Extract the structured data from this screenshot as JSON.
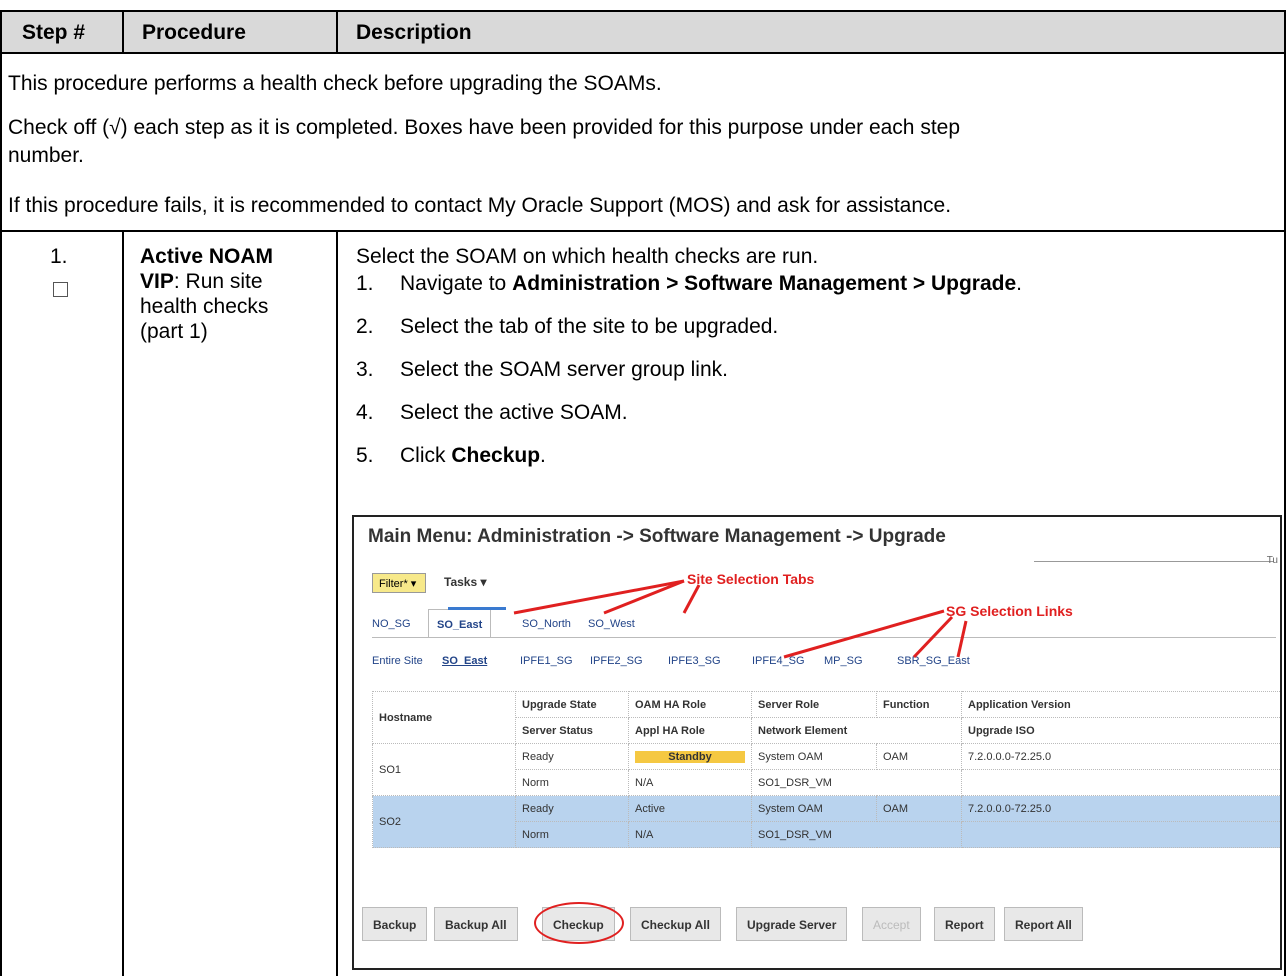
{
  "header": {
    "step": "Step #",
    "procedure": "Procedure",
    "description": "Description"
  },
  "intro": {
    "line1": "This procedure performs a health check before upgrading the SOAMs.",
    "line2a": "Check off (√) each step as it is completed.  Boxes have been provided for this purpose under each step",
    "line2b": "number.",
    "line3": "If this procedure fails, it is recommended to contact My Oracle Support (MOS) and ask for assistance."
  },
  "step": {
    "number": "1.",
    "proc_bold1": "Active NOAM",
    "proc_bold2": "VIP",
    "proc_rest": ": Run site",
    "proc_line2": "health checks",
    "proc_line3": "(part 1)",
    "lead": "Select the SOAM on which health checks are run.",
    "items": [
      {
        "num": "1.",
        "pre": "Navigate to ",
        "bold": "Administration > Software Management > Upgrade",
        "post": "."
      },
      {
        "num": "2.",
        "pre": "Select the tab of the site to be upgraded.",
        "bold": "",
        "post": ""
      },
      {
        "num": "3.",
        "pre": "Select the SOAM server group link.",
        "bold": "",
        "post": ""
      },
      {
        "num": "4.",
        "pre": "Select the active SOAM.",
        "bold": "",
        "post": ""
      },
      {
        "num": "5.",
        "pre": "Click ",
        "bold": "Checkup",
        "post": "."
      }
    ]
  },
  "screenshot": {
    "title": "Main Menu: Administration -> Software Management -> Upgrade",
    "corner": "Tu",
    "filter": "Filter* ▾",
    "tasks": "Tasks ▾",
    "anno_tabs": "Site Selection Tabs",
    "anno_links": "SG Selection Links",
    "tabs": [
      "NO_SG",
      "SO_East",
      "SO_North",
      "SO_West"
    ],
    "sg_links": [
      "Entire Site",
      "SO_East",
      "IPFE1_SG",
      "IPFE2_SG",
      "IPFE3_SG",
      "IPFE4_SG",
      "MP_SG",
      "SBR_SG_East"
    ],
    "columns_top": [
      "Hostname",
      "Upgrade State",
      "OAM HA Role",
      "Server Role",
      "Function",
      "Application Version"
    ],
    "columns_bottom": [
      "Server Status",
      "Appl HA Role",
      "Network Element",
      "Upgrade ISO"
    ],
    "rows": [
      {
        "host": "SO1",
        "state": "Ready",
        "oam": "Standby",
        "role": "System OAM",
        "func": "OAM",
        "ver": "7.2.0.0.0-72.25.0",
        "status": "Norm",
        "appl": "N/A",
        "ne": "SO1_DSR_VM"
      },
      {
        "host": "SO2",
        "state": "Ready",
        "oam": "Active",
        "role": "System OAM",
        "func": "OAM",
        "ver": "7.2.0.0.0-72.25.0",
        "status": "Norm",
        "appl": "N/A",
        "ne": "SO1_DSR_VM"
      }
    ],
    "buttons": [
      "Backup",
      "Backup All",
      "Checkup",
      "Checkup All",
      "Upgrade Server",
      "Accept",
      "Report",
      "Report All"
    ]
  }
}
